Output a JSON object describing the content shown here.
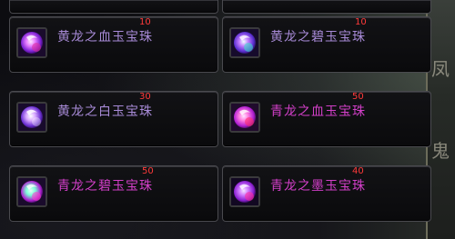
{
  "items": [
    {
      "name": "黄龙之血玉宝珠",
      "count": "10",
      "color": "#a78ad6"
    },
    {
      "name": "黄龙之碧玉宝珠",
      "count": "10",
      "color": "#a78ad6"
    },
    {
      "name": "黄龙之白玉宝珠",
      "count": "30",
      "color": "#a78ad6"
    },
    {
      "name": "青龙之血玉宝珠",
      "count": "50",
      "color": "#d23fc8"
    },
    {
      "name": "青龙之碧玉宝珠",
      "count": "50",
      "color": "#d23fc8"
    },
    {
      "name": "青龙之墨玉宝珠",
      "count": "40",
      "color": "#d23fc8"
    }
  ],
  "icon_name": "jade-orb-icon",
  "side_glyphs": [
    "凤",
    "鬼"
  ]
}
